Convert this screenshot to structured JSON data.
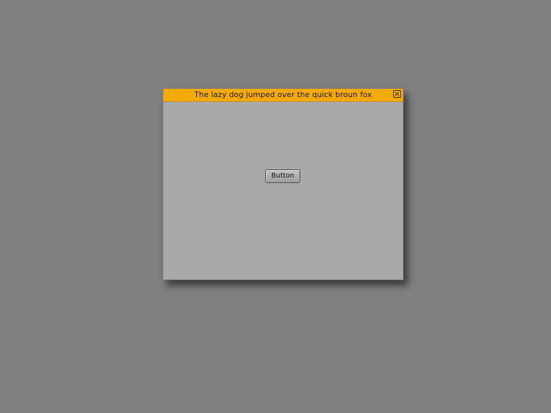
{
  "desktop": {
    "background_color": "#808080"
  },
  "window": {
    "title": "The lazy dog jumped over the quick broun fox",
    "titlebar_color": "#ffae00",
    "client_color": "#a9a9a9",
    "close_icon": "close-icon"
  },
  "content": {
    "button_label": "Button"
  }
}
